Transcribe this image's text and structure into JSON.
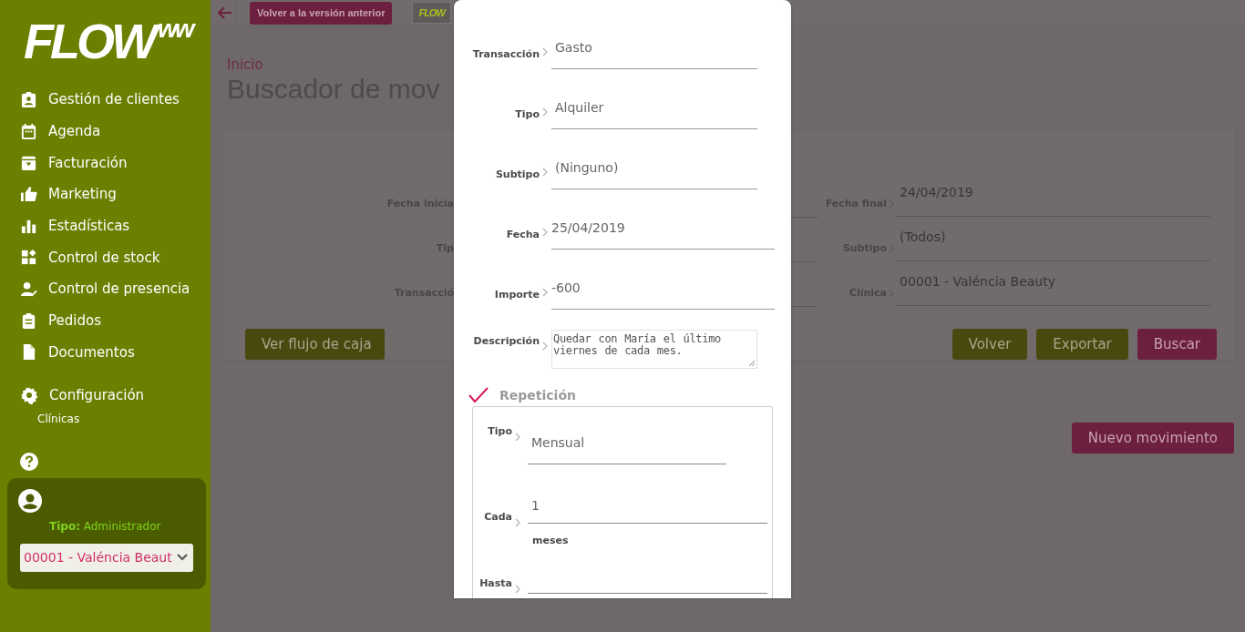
{
  "sidebar": {
    "logo": {
      "text": "FLOW",
      "suffix": "ww"
    },
    "menu": [
      {
        "label": "Gestión de clientes"
      },
      {
        "label": "Agenda"
      },
      {
        "label": "Facturación"
      },
      {
        "label": "Marketing"
      },
      {
        "label": "Estadísticas"
      },
      {
        "label": "Control de stock"
      },
      {
        "label": "Control de presencia"
      },
      {
        "label": "Pedidos"
      },
      {
        "label": "Documentos"
      }
    ],
    "settings": {
      "label": "Configuración",
      "children": [
        {
          "label": "Clínicas"
        }
      ]
    },
    "user": {
      "role": "**Tipo:** Administrador",
      "clinic": "00001 - Valéncia Beaut"
    }
  },
  "topbar": {
    "back_button": "Volver a la versión anterior",
    "logo": "FLOW"
  },
  "page": {
    "breadcrumb": "Inicio",
    "title": "Buscador de mov",
    "left_labels": [
      "Fecha inicia",
      "Tip",
      "Transacció"
    ],
    "right_fields": [
      {
        "label": "Fecha final",
        "value": "24/04/2019"
      },
      {
        "label": "Subtipo",
        "value": "(Todos)"
      },
      {
        "label": "Clínica",
        "value": "00001 - Valéncia Beauty"
      }
    ],
    "left_button": {
      "label": "Ver flujo de caja",
      "kind": "secondary"
    },
    "buttons": [
      {
        "label": "Volver",
        "kind": "secondary"
      },
      {
        "label": "Exportar",
        "kind": "secondary"
      },
      {
        "label": "Buscar",
        "kind": "primary"
      }
    ],
    "new_button": {
      "label": "Nuevo movimiento",
      "kind": "primary"
    }
  },
  "modal": {
    "fields": [
      {
        "label": "Transacción",
        "value": "Gasto",
        "wide": false
      },
      {
        "label": "Tipo",
        "value": "Alquiler",
        "wide": false
      },
      {
        "label": "Subtipo",
        "value": "(Ninguno)",
        "wide": false
      },
      {
        "label": "Fecha",
        "value": "25/04/2019",
        "wide": true
      },
      {
        "label": "Importe",
        "value": "-600",
        "wide": true
      }
    ],
    "description": {
      "label": "Descripción",
      "value": "Quedar con María el último viernes de cada mes."
    },
    "repetition": {
      "label": "Repetición",
      "checked": true,
      "fields": [
        {
          "label": "Tipo",
          "value": "Mensual"
        },
        {
          "label": "Cada",
          "value": "1",
          "unit": "meses"
        },
        {
          "label": "Hasta"
        }
      ]
    }
  }
}
